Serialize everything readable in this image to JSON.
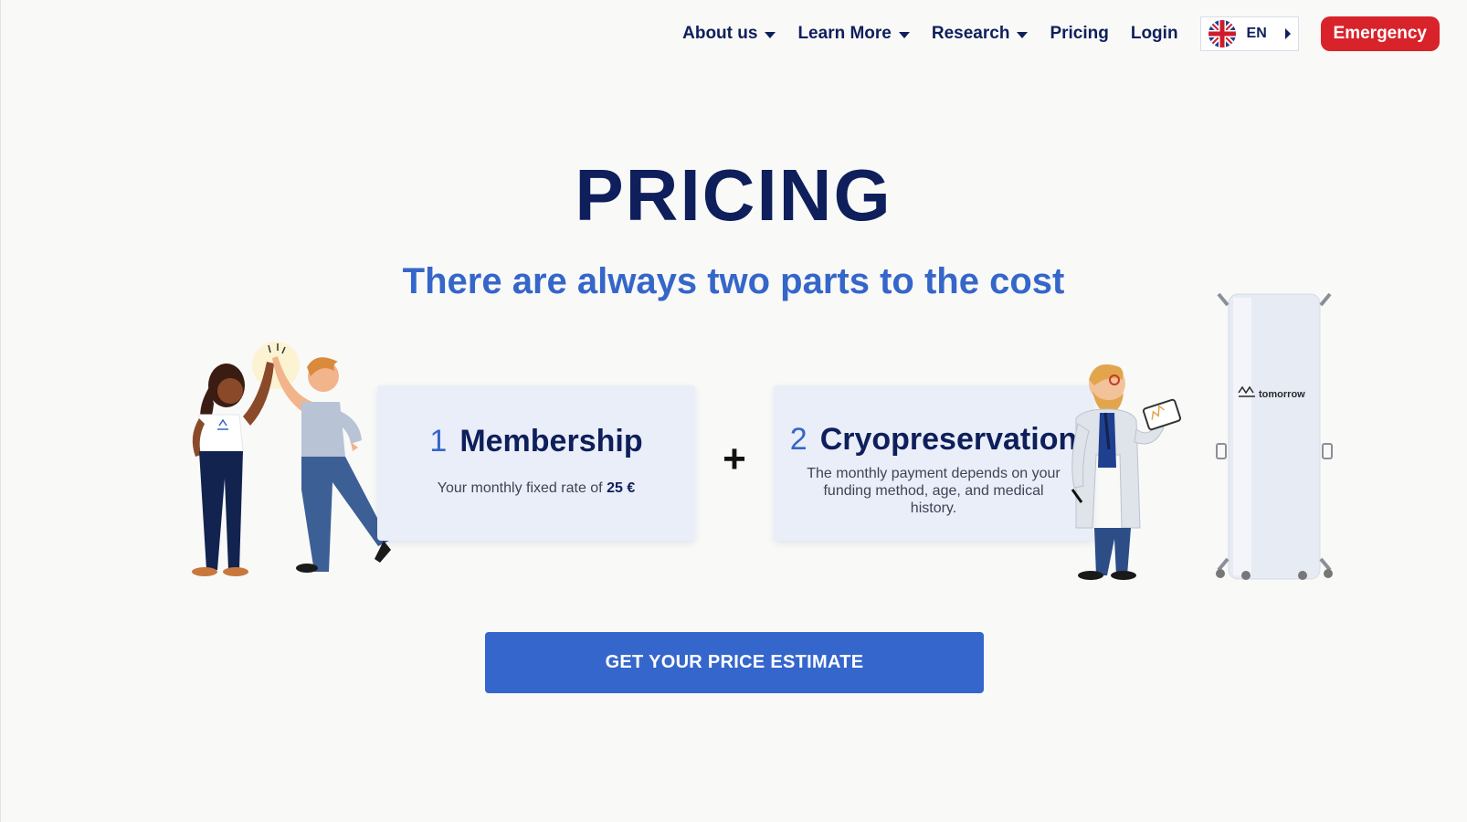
{
  "nav": {
    "items": [
      {
        "label": "About us",
        "has_dropdown": true
      },
      {
        "label": "Learn More",
        "has_dropdown": true
      },
      {
        "label": "Research",
        "has_dropdown": true
      },
      {
        "label": "Pricing",
        "has_dropdown": false
      },
      {
        "label": "Login",
        "has_dropdown": false
      }
    ],
    "language": {
      "code": "EN",
      "flag": "uk-flag-icon"
    },
    "emergency_label": "Emergency"
  },
  "hero": {
    "title": "PRICING",
    "subtitle": "There are always two parts to the cost"
  },
  "cards": [
    {
      "number": "1",
      "title": "Membership",
      "description": "Your monthly fixed rate of",
      "price": "25 €"
    },
    {
      "number": "2",
      "title": "Cryopreservation",
      "description": "The monthly payment depends on your funding method, age, and medical history."
    }
  ],
  "plus_sign": "+",
  "cta_label": "GET YOUR PRICE ESTIMATE",
  "tank_brand": "tomorrow",
  "colors": {
    "navy": "#0e1f5b",
    "accent_blue": "#3566cc",
    "emergency_red": "#d8232a",
    "card_bg": "#eaeef8",
    "page_bg": "#f9f9f8"
  }
}
